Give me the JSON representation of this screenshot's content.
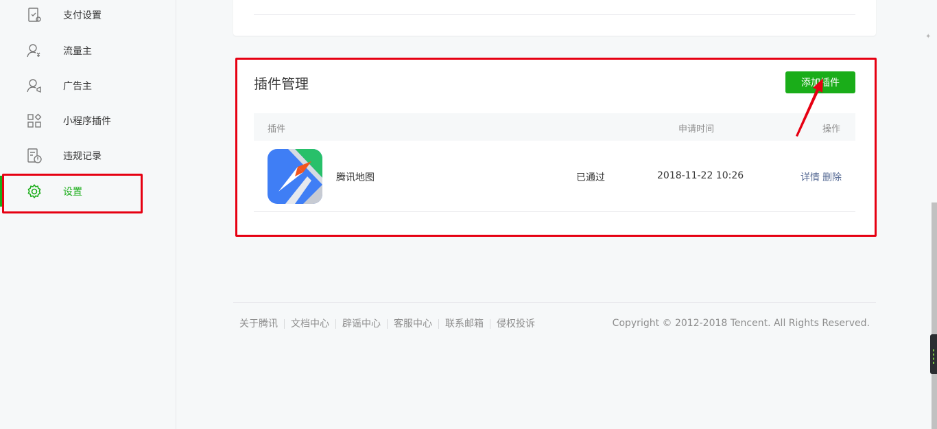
{
  "sidebar": {
    "items": [
      {
        "label": "支付设置",
        "icon": "payment-settings-icon"
      },
      {
        "label": "流量主",
        "icon": "traffic-owner-icon"
      },
      {
        "label": "广告主",
        "icon": "advertiser-icon"
      },
      {
        "label": "小程序插件",
        "icon": "plugin-grid-icon"
      },
      {
        "label": "违规记录",
        "icon": "violation-record-icon"
      },
      {
        "label": "设置",
        "icon": "settings-gear-icon",
        "active": true
      }
    ]
  },
  "plugin_section": {
    "title": "插件管理",
    "add_button": "添加插件",
    "columns": {
      "plugin": "插件",
      "apply_time": "申请时间",
      "operation": "操作"
    },
    "rows": [
      {
        "name": "腾讯地图",
        "status": "已通过",
        "time": "2018-11-22 10:26",
        "detail": "详情",
        "delete": "删除"
      }
    ]
  },
  "footer": {
    "links": [
      "关于腾讯",
      "文档中心",
      "辟谣中心",
      "客服中心",
      "联系邮箱",
      "侵权投诉"
    ],
    "copyright": "Copyright © 2012-2018 Tencent. All Rights Reserved."
  },
  "colors": {
    "accent": "#1aad19",
    "annotation_red": "#e60012",
    "link": "#576b95"
  }
}
